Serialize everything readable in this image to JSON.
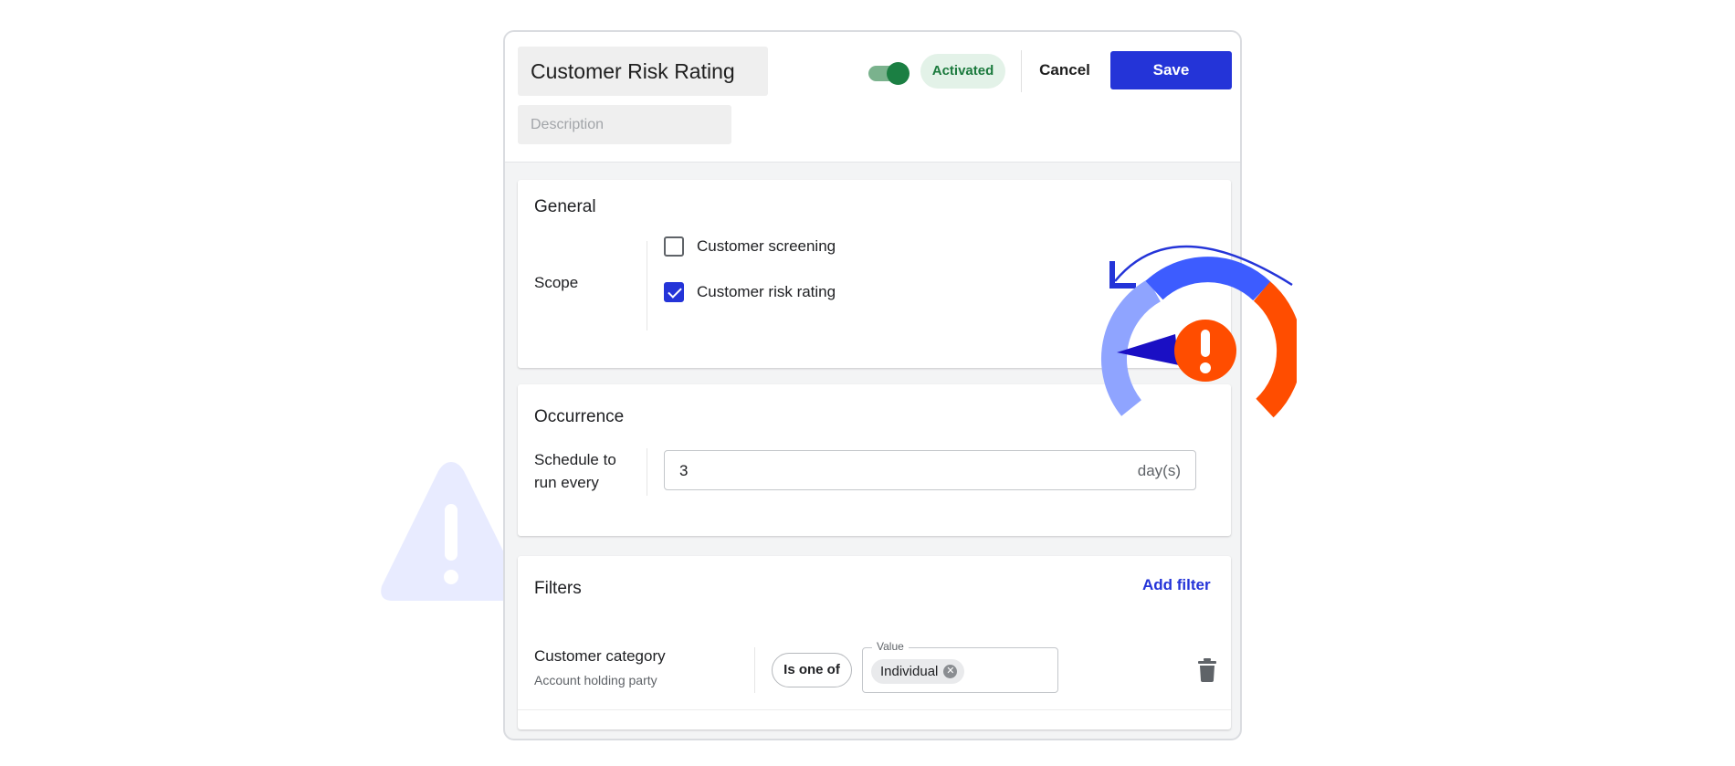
{
  "header": {
    "title": "Customer Risk Rating",
    "description_placeholder": "Description",
    "status": "Activated",
    "cancel_label": "Cancel",
    "save_label": "Save",
    "toggle_on": true
  },
  "general": {
    "title": "General",
    "scope_label": "Scope",
    "options": [
      {
        "label": "Customer screening",
        "checked": false
      },
      {
        "label": "Customer risk rating",
        "checked": true
      }
    ]
  },
  "occurrence": {
    "title": "Occurrence",
    "schedule_label": "Schedule to run every",
    "interval_value": "3",
    "interval_unit": "day(s)"
  },
  "filters": {
    "title": "Filters",
    "add_label": "Add filter",
    "rows": [
      {
        "label": "Customer category",
        "sublabel": "Account holding party",
        "operator": "Is one of",
        "value_legend": "Value",
        "values": [
          "Individual"
        ]
      }
    ]
  },
  "icons": {
    "status_toggle": "toggle-on-icon",
    "checkbox_checked": "checkbox-checked-icon",
    "checkbox_unchecked": "checkbox-unchecked-icon",
    "chip_remove": "close-circle-icon",
    "delete": "trash-icon",
    "illustration": "risk-gauge-icon",
    "background": "warning-triangle-icon"
  },
  "colors": {
    "primary": "#2434d8",
    "success": "#1b7f43",
    "success_bg": "#e3f2e8",
    "gauge_low": "#8fa4ff",
    "gauge_mid": "#3d5cff",
    "gauge_high": "#ff4d00",
    "warning_bg": "#e8ebff"
  }
}
